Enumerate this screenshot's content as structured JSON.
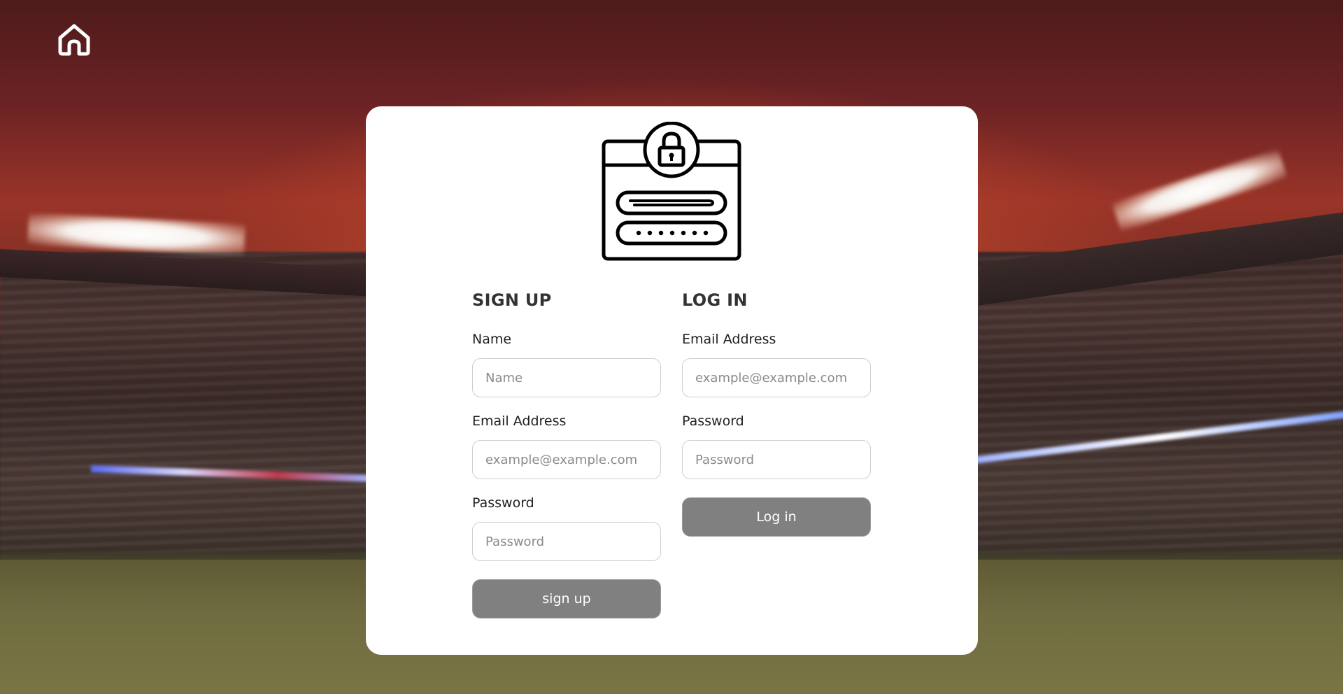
{
  "nav": {
    "home_icon": "home-icon"
  },
  "illustration": {
    "icon": "login-lock-icon"
  },
  "signup": {
    "title": "SIGN UP",
    "name_label": "Name",
    "name_placeholder": "Name",
    "email_label": "Email Address",
    "email_placeholder": "example@example.com",
    "password_label": "Password",
    "password_placeholder": "Password",
    "button_label": "sign up"
  },
  "login": {
    "title": "LOG IN",
    "email_label": "Email Address",
    "email_placeholder": "example@example.com",
    "password_label": "Password",
    "password_placeholder": "Password",
    "button_label": "Log in"
  },
  "colors": {
    "button_bg": "#808080",
    "card_bg": "#ffffff",
    "title_text": "#333333"
  }
}
